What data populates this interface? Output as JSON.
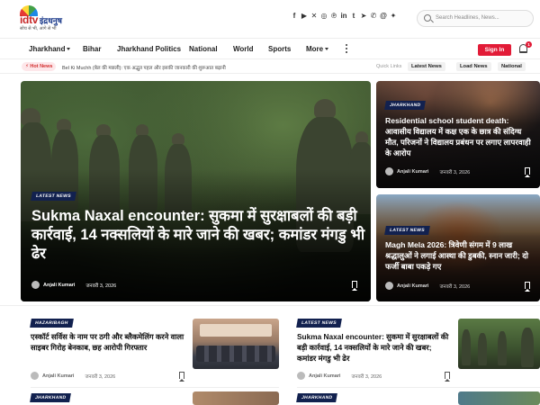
{
  "header": {
    "logo": {
      "word_idtv": "idtv",
      "word_hindi": "इंद्रधनुष",
      "tagline": "सोच से भी, आगे से भी"
    },
    "social_icons": [
      "facebook-icon",
      "youtube-icon",
      "x-twitter-icon",
      "instagram-icon",
      "pinterest-icon",
      "linkedin-icon",
      "tumblr-icon",
      "telegram-icon",
      "whatsapp-icon",
      "threads-icon",
      "bluesky-icon"
    ],
    "social_glyphs": [
      "f",
      "▶",
      "✕",
      "◎",
      "℗",
      "in",
      "t",
      "➤",
      "✆",
      "@",
      "✦"
    ],
    "search": {
      "placeholder": "Search Headlines, News..."
    }
  },
  "nav": {
    "items": [
      {
        "label": "Jharkhand",
        "dropdown": true
      },
      {
        "label": "Bihar",
        "dropdown": false
      },
      {
        "label": "Jharkhand Politics",
        "dropdown": false
      },
      {
        "label": "National",
        "dropdown": false
      },
      {
        "label": "World",
        "dropdown": false
      },
      {
        "label": "Sports",
        "dropdown": false
      },
      {
        "label": "More",
        "dropdown": true
      }
    ],
    "signin_label": "Sign In",
    "notification_count": "1"
  },
  "ticker": {
    "badge": "Hot News",
    "text": "Bel Ki Muchh (बेल की मछली): एक अद्भुत पहल और इसकी जानकारी की शुरूआत बढ़ानी",
    "quick_label": "Quick Links",
    "quick_links": [
      "Latest News",
      "Load News",
      "National"
    ]
  },
  "hero": {
    "tag": "LATEST NEWS",
    "title": "Sukma Naxal encounter: सुकमा में सुरक्षाबलों की बड़ी कार्रवाई, 14 नक्सलियों के मारे जाने की खबर; कमांडर मंगडु भी ढेर",
    "author": "Anjali Kumari",
    "date": "जनवरी 3, 2026"
  },
  "side_cards": [
    {
      "tag": "JHARKHAND",
      "title": "Residential school student death: आवासीय विद्यालय में कक्ष एक के छात्र की संदिग्ध मौत, परिजनों ने विद्यालय प्रबंधन पर लगाए लापरवाही के आरोप",
      "author": "Anjali Kumari",
      "date": "जनवरी 3, 2026"
    },
    {
      "tag": "LATEST NEWS",
      "title": "Magh Mela 2026: त्रिवेणी संगम में 9 लाख श्रद्धालुओं ने लगाई आस्था की डुबकी, स्नान जारी; दो फर्जी बाबा पकड़े गए",
      "author": "Anjali Kumari",
      "date": "जनवरी 3, 2026"
    }
  ],
  "list_cards": [
    {
      "tag": "HAZARIBAGH",
      "title": "एस्कॉर्ट सर्विस के नाम पर ठगी और ब्लैकमेलिंग करने वाला साइबर गिरोह बेनकाब, छह आरोपी गिरफ्तार",
      "author": "Anjali Kumari",
      "date": "जनवरी 3, 2026"
    },
    {
      "tag": "LATEST NEWS",
      "title": "Sukma Naxal encounter: सुकमा में सुरक्षाबलों की बड़ी कार्रवाई, 14 नक्सलियों के मारे जाने की खबर; कमांडर मंगडु भी ढेर",
      "author": "Anjali Kumari",
      "date": "जनवरी 3, 2026"
    }
  ],
  "next_tags": [
    "JHARKHAND",
    "JHARKHAND"
  ],
  "colors": {
    "accent_red": "#e21b37",
    "tag_navy": "#12214f",
    "brand_blue": "#1b3a8a"
  }
}
